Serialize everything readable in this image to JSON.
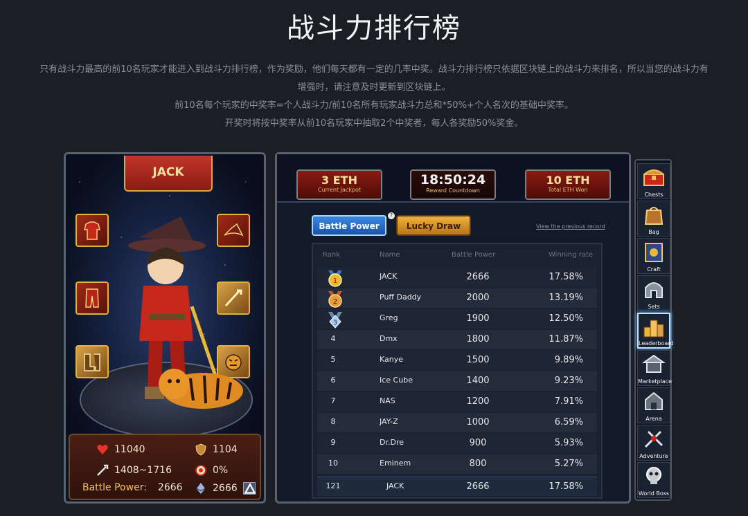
{
  "header": {
    "title": "战斗力排行榜",
    "desc_line1": "只有战斗力最高的前10名玩家才能进入到战斗力排行榜，作为奖励，他们每天都有一定的几率中奖。战斗力排行榜只依据区块链上的战斗力来排名，所以当您的战斗力有",
    "desc_line2": "增强时，请注意及时更新到区块链上。",
    "desc_line3": "前10名每个玩家的中奖率=个人战斗力/前10名所有玩家战斗力总和*50%+个人名次的基础中奖率。",
    "desc_line4": "开奖时将按中奖率从前10名玩家中抽取2个中奖者，每人各奖励50%奖金。"
  },
  "character": {
    "name": "JACK",
    "equip_slots": [
      "armor-icon",
      "hat-icon",
      "pants-icon",
      "weapon-icon",
      "boots-icon",
      "pet-icon"
    ],
    "stats": {
      "hp": "11040",
      "defense": "1104",
      "attack": "1408~1716",
      "crit": "0%",
      "battle_power_label": "Battle Power:",
      "battle_power": "2666",
      "chain_power": "2666"
    }
  },
  "jackpot": {
    "current_value": "3 ETH",
    "current_label": "Current Jackpot",
    "countdown_value": "18:50:24",
    "countdown_label": "Reward Countdown",
    "total_value": "10 ETH",
    "total_label": "Total ETH Won"
  },
  "tabs": {
    "battle_power": "Battle Power",
    "lucky_draw": "Lucky Draw",
    "help": "?",
    "previous_record": "View the previous record"
  },
  "table": {
    "headers": {
      "rank": "Rank",
      "name": "Name",
      "power": "Battle Power",
      "rate": "Winning rate"
    },
    "rows": [
      {
        "rank": "1",
        "name": "JACK",
        "power": "2666",
        "rate": "17.58%"
      },
      {
        "rank": "2",
        "name": "Puff Daddy",
        "power": "2000",
        "rate": "13.19%"
      },
      {
        "rank": "3",
        "name": "Greg",
        "power": "1900",
        "rate": "12.50%"
      },
      {
        "rank": "4",
        "name": "Dmx",
        "power": "1800",
        "rate": "11.87%"
      },
      {
        "rank": "5",
        "name": "Kanye",
        "power": "1500",
        "rate": "9.89%"
      },
      {
        "rank": "6",
        "name": "Ice Cube",
        "power": "1400",
        "rate": "9.23%"
      },
      {
        "rank": "7",
        "name": "NAS",
        "power": "1200",
        "rate": "7.91%"
      },
      {
        "rank": "8",
        "name": "JAY-Z",
        "power": "1000",
        "rate": "6.59%"
      },
      {
        "rank": "9",
        "name": "Dr.Dre",
        "power": "900",
        "rate": "5.93%"
      },
      {
        "rank": "10",
        "name": "Eminem",
        "power": "800",
        "rate": "5.27%"
      }
    ],
    "self_row": {
      "rank": "121",
      "name": "JACK",
      "power": "2666",
      "rate": "17.58%"
    }
  },
  "side_menu": [
    {
      "label": "Chests",
      "icon": "chest-icon"
    },
    {
      "label": "Bag",
      "icon": "bag-icon"
    },
    {
      "label": "Craft",
      "icon": "craft-book-icon"
    },
    {
      "label": "Sets",
      "icon": "helmet-icon"
    },
    {
      "label": "Leaderboard",
      "icon": "leaderboard-icon",
      "active": true
    },
    {
      "label": "Marketplace",
      "icon": "market-tent-icon"
    },
    {
      "label": "Arena",
      "icon": "arena-icon"
    },
    {
      "label": "Adventure",
      "icon": "adventure-sword-icon"
    },
    {
      "label": "World Boss",
      "icon": "boss-skull-icon"
    }
  ],
  "colors": {
    "background": "#1b1e24",
    "accent_gold": "#f4c25c",
    "accent_red": "#8a1c14",
    "accent_blue": "#1c52a8"
  }
}
